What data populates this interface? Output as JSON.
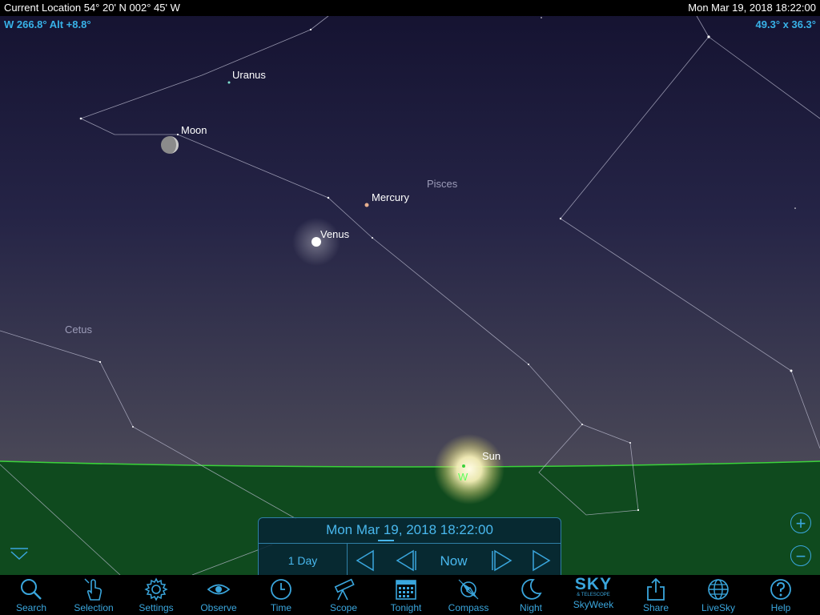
{
  "status_bar": {
    "location": "Current Location  54° 20' N 002° 45' W",
    "datetime": "Mon Mar 19, 2018   18:22:00"
  },
  "hud": {
    "direction": "W 266.8° Alt +8.8°",
    "field_of_view": "49.3° x 36.3°"
  },
  "sky_objects": {
    "uranus": "Uranus",
    "moon": "Moon",
    "mercury": "Mercury",
    "venus": "Venus",
    "sun": "Sun"
  },
  "constellations": {
    "pisces": "Pisces",
    "cetus": "Cetus"
  },
  "horizon": {
    "west_marker": "W"
  },
  "time_panel": {
    "date_time": "Mon Mar 19, 2018   18:22:00",
    "step": "1 Day",
    "now_label": "Now"
  },
  "zoom": {
    "zoom_in": "+",
    "zoom_out": "−"
  },
  "toolbar": {
    "items": [
      {
        "label": "Search",
        "icon": "search-icon"
      },
      {
        "label": "Selection",
        "icon": "hand-pointer-icon"
      },
      {
        "label": "Settings",
        "icon": "gear-icon"
      },
      {
        "label": "Observe",
        "icon": "eye-icon"
      },
      {
        "label": "Time",
        "icon": "clock-icon"
      },
      {
        "label": "Scope",
        "icon": "telescope-icon"
      },
      {
        "label": "Tonight",
        "icon": "calendar-icon"
      },
      {
        "label": "Compass",
        "icon": "compass-icon"
      },
      {
        "label": "Night",
        "icon": "moon-icon"
      },
      {
        "label": "SkyWeek",
        "icon": "sky-telescope-logo"
      },
      {
        "label": "Share",
        "icon": "share-icon"
      },
      {
        "label": "LiveSky",
        "icon": "globe-icon"
      },
      {
        "label": "Help",
        "icon": "help-icon"
      }
    ],
    "skyweek_logo_text": "SKY",
    "skyweek_logo_sub": "& TELESCOPE"
  },
  "colors": {
    "sky_top": "#151331",
    "sky_horizon": "#4a4858",
    "ground": "#0f4a1e",
    "horizon_line": "#3bd23b",
    "accent": "#3aa6dd"
  }
}
